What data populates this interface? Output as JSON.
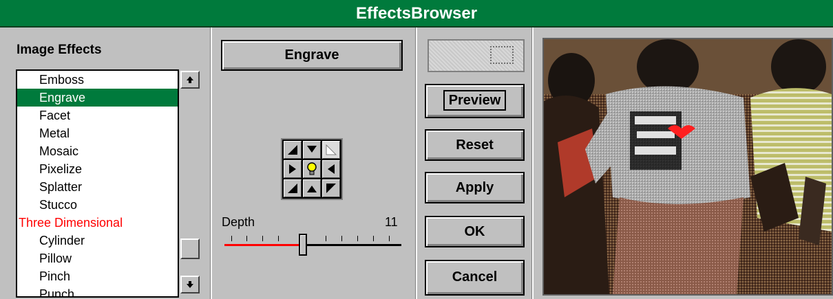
{
  "window": {
    "title": "EffectsBrowser"
  },
  "effects_panel": {
    "title": "Image Effects",
    "items": [
      {
        "label": "Emboss",
        "kind": "item"
      },
      {
        "label": "Engrave",
        "kind": "selected"
      },
      {
        "label": "Facet",
        "kind": "item"
      },
      {
        "label": "Metal",
        "kind": "item"
      },
      {
        "label": "Mosaic",
        "kind": "item"
      },
      {
        "label": "Pixelize",
        "kind": "item"
      },
      {
        "label": "Splatter",
        "kind": "item"
      },
      {
        "label": "Stucco",
        "kind": "item"
      },
      {
        "label": "Three Dimensional",
        "kind": "category"
      },
      {
        "label": "Cylinder",
        "kind": "item"
      },
      {
        "label": "Pillow",
        "kind": "item"
      },
      {
        "label": "Pinch",
        "kind": "item"
      },
      {
        "label": "Punch",
        "kind": "item"
      }
    ],
    "scroll_up_icon": "arrow-up-icon",
    "scroll_down_icon": "arrow-down-icon"
  },
  "options": {
    "effect_button": "Engrave",
    "light_direction_icons": [
      "arrow-up-left-icon",
      "arrow-down-icon",
      "corner-triangle-icon",
      "arrow-right-icon",
      "lightbulb-icon",
      "arrow-left-icon",
      "arrow-down-right-icon",
      "arrow-up-icon",
      "arrow-down-left-icon"
    ],
    "depth": {
      "label": "Depth",
      "value": "11",
      "fraction": 0.44
    }
  },
  "actions": {
    "preview": "Preview",
    "reset": "Reset",
    "apply": "Apply",
    "ok": "OK",
    "cancel": "Cancel"
  },
  "colors": {
    "title_bar": "#007a3c",
    "selection": "#007a3c",
    "category_text": "#ff0000",
    "slider_fill": "#ff0000",
    "lightbulb": "#ffff00"
  }
}
